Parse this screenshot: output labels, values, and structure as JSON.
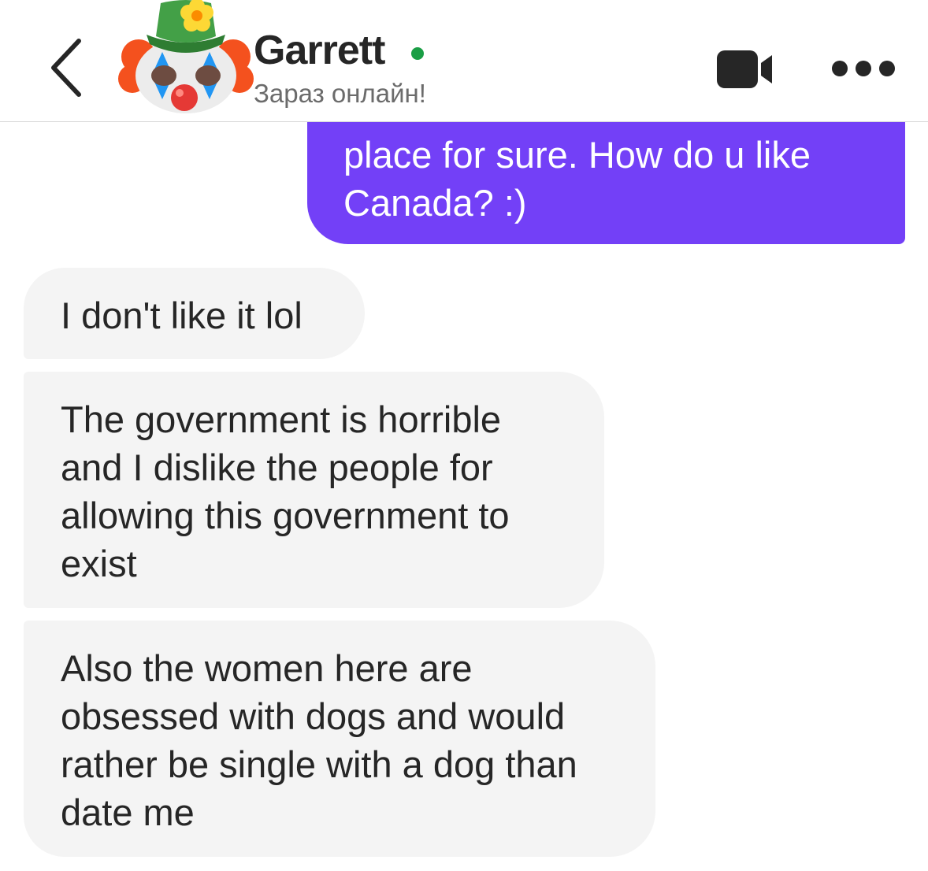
{
  "header": {
    "contact_name": "Garrett",
    "status": "Зараз онлайн!",
    "icons": {
      "back": "chevron-left-icon",
      "avatar": "clown-face-avatar",
      "online": "online-dot",
      "video": "video-camera-icon",
      "more": "more-horizontal-icon"
    }
  },
  "messages": [
    {
      "direction": "sent",
      "text": "place for sure. How do u like Canada? :)"
    },
    {
      "direction": "received",
      "text": "I don't like it lol"
    },
    {
      "direction": "received",
      "text": "The government is horrible and I dislike the people for allowing this government to exist"
    },
    {
      "direction": "received",
      "text": "Also the women here are obsessed with dogs and would rather be single with a dog than date me"
    }
  ],
  "colors": {
    "sent_bubble": "#7340f7",
    "received_bubble": "#f4f4f4",
    "online_dot": "#1a9e45",
    "text_dark": "#262626"
  }
}
